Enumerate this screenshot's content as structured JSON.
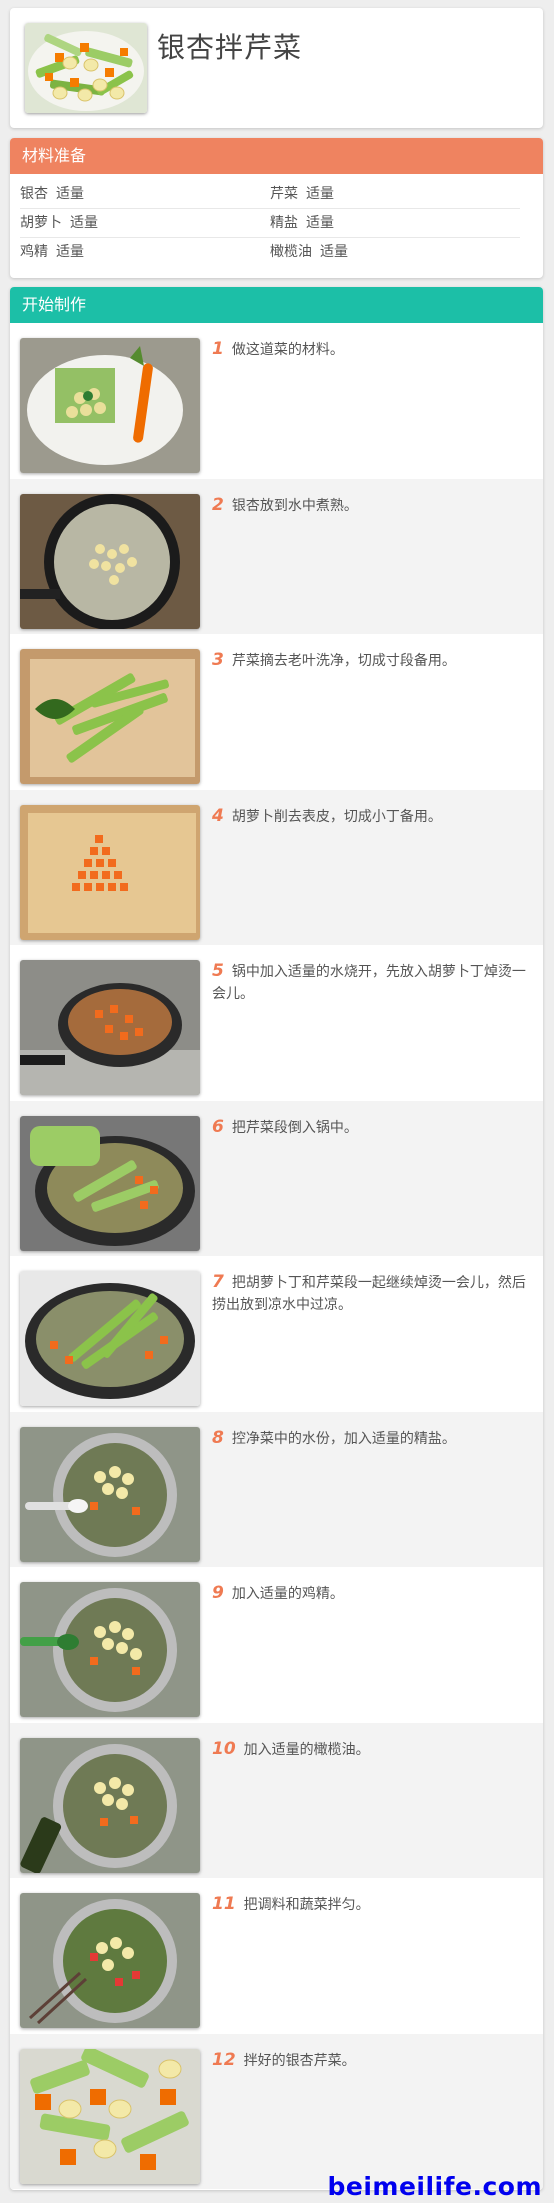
{
  "recipe": {
    "title": "银杏拌芹菜",
    "cover_alt": "银杏拌芹菜成品"
  },
  "ingredients": {
    "heading": "材料准备",
    "items": [
      {
        "name": "银杏",
        "qty": "适量"
      },
      {
        "name": "芹菜",
        "qty": "适量"
      },
      {
        "name": "胡萝卜",
        "qty": "适量"
      },
      {
        "name": "精盐",
        "qty": "适量"
      },
      {
        "name": "鸡精",
        "qty": "适量"
      },
      {
        "name": "橄榄油",
        "qty": "适量"
      }
    ]
  },
  "steps": {
    "heading": "开始制作",
    "items": [
      {
        "num": "1",
        "text": "做这道菜的材料。"
      },
      {
        "num": "2",
        "text": "银杏放到水中煮熟。"
      },
      {
        "num": "3",
        "text": "芹菜摘去老叶洗净，切成寸段备用。"
      },
      {
        "num": "4",
        "text": "胡萝卜削去表皮，切成小丁备用。"
      },
      {
        "num": "5",
        "text": "锅中加入适量的水烧开，先放入胡萝卜丁焯烫一会儿。"
      },
      {
        "num": "6",
        "text": "把芹菜段倒入锅中。"
      },
      {
        "num": "7",
        "text": "把胡萝卜丁和芹菜段一起继续焯烫一会儿，然后捞出放到凉水中过凉。"
      },
      {
        "num": "8",
        "text": "控净菜中的水份，加入适量的精盐。"
      },
      {
        "num": "9",
        "text": "加入适量的鸡精。"
      },
      {
        "num": "10",
        "text": "加入适量的橄榄油。"
      },
      {
        "num": "11",
        "text": "把调料和蔬菜拌匀。"
      },
      {
        "num": "12",
        "text": "拌好的银杏芹菜。"
      }
    ]
  },
  "watermark": "beimeilife.com",
  "colors": {
    "ingredients_header": "#ef8360",
    "steps_header": "#1cbfa7",
    "step_number": "#ef7a52",
    "watermark": "#0000ee"
  }
}
